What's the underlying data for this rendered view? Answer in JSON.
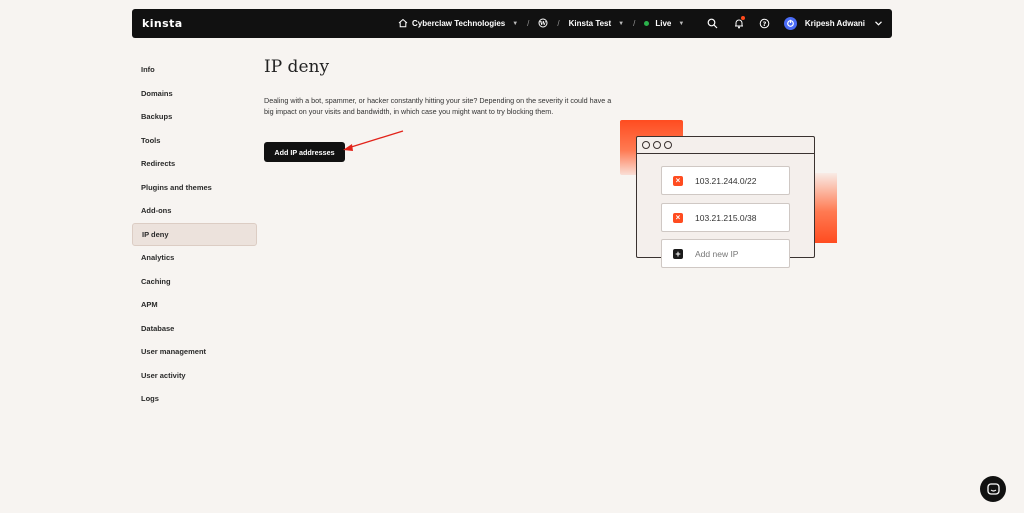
{
  "topbar": {
    "logo": "kinsta",
    "company": "Cyberclaw Technologies",
    "site": "Kinsta Test",
    "environment": "Live",
    "user_name": "Kripesh Adwani",
    "live_color": "#2bb24c",
    "icons": [
      "home-icon",
      "wordpress-icon",
      "search-icon",
      "bell-icon",
      "help-icon",
      "user-avatar-icon",
      "chevron-down-icon"
    ]
  },
  "sidebar": {
    "items": [
      {
        "label": "Info"
      },
      {
        "label": "Domains"
      },
      {
        "label": "Backups"
      },
      {
        "label": "Tools"
      },
      {
        "label": "Redirects"
      },
      {
        "label": "Plugins and themes"
      },
      {
        "label": "Add-ons"
      },
      {
        "label": "IP deny",
        "active": true
      },
      {
        "label": "Analytics"
      },
      {
        "label": "Caching"
      },
      {
        "label": "APM"
      },
      {
        "label": "Database"
      },
      {
        "label": "User management"
      },
      {
        "label": "User activity"
      },
      {
        "label": "Logs"
      }
    ]
  },
  "main": {
    "title": "IP deny",
    "description": "Dealing with a bot, spammer, or hacker constantly hitting your site? Depending on the severity it could have a big impact on your visits and bandwidth, in which case you might want to try blocking them.",
    "add_button_label": "Add IP addresses",
    "accent_color": "#ff4c20"
  },
  "illustration": {
    "ip_1": "103.21.244.0/22",
    "ip_2": "103.21.215.0/38",
    "add_new_label": "Add new IP"
  }
}
